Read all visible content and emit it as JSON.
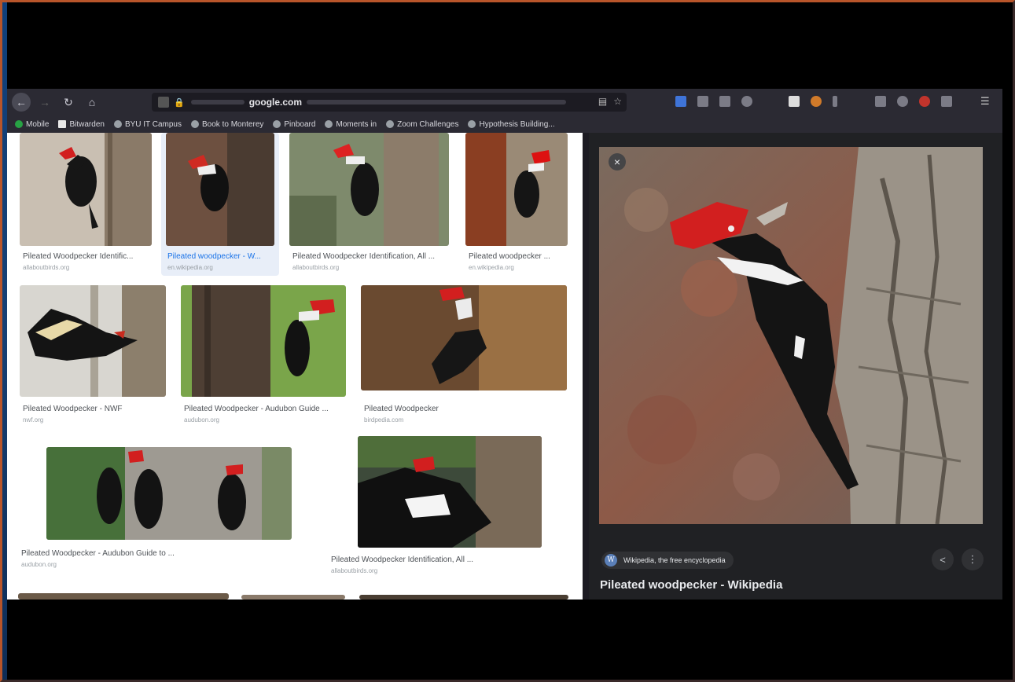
{
  "browser": {
    "url": {
      "host": "google.com"
    },
    "bookmarks": [
      {
        "label": "Mobile",
        "icon": "green-dot-icon"
      },
      {
        "label": "Bitwarden",
        "icon": "square-icon"
      },
      {
        "label": "BYU IT Campus",
        "icon": "globe-icon"
      },
      {
        "label": "Book to Monterey",
        "icon": "globe-icon"
      },
      {
        "label": "Pinboard",
        "icon": "globe-icon"
      },
      {
        "label": "Moments in",
        "icon": "globe-icon"
      },
      {
        "label": "Zoom Challenges",
        "icon": "globe-icon"
      },
      {
        "label": "Hypothesis Building...",
        "icon": "globe-icon"
      }
    ]
  },
  "results": [
    {
      "title": "Pileated Woodpecker Identific...",
      "domain": "allaboutbirds.org"
    },
    {
      "title": "Pileated woodpecker - W...",
      "domain": "en.wikipedia.org"
    },
    {
      "title": "Pileated Woodpecker Identification, All ...",
      "domain": "allaboutbirds.org"
    },
    {
      "title": "Pileated woodpecker ...",
      "domain": "en.wikipedia.org"
    },
    {
      "title": "Pileated Woodpecker - NWF",
      "domain": "nwf.org"
    },
    {
      "title": "Pileated Woodpecker - Audubon Guide ...",
      "domain": "audubon.org"
    },
    {
      "title": "Pileated Woodpecker",
      "domain": "birdpedia.com"
    },
    {
      "title": "Pileated Woodpecker - Audubon Guide to ...",
      "domain": "audubon.org"
    },
    {
      "title": "Pileated Woodpecker Identification, All ...",
      "domain": "allaboutbirds.org"
    }
  ],
  "preview": {
    "source": "Wikipedia, the free encyclopedia",
    "title": "Pileated woodpecker - Wikipedia",
    "close_icon": "×",
    "share_icon": "<",
    "more_icon": "⋮"
  },
  "colors": {
    "toolbar": "#2b2a33",
    "preview_bg": "#202124",
    "bird_red": "#d21f1f"
  }
}
